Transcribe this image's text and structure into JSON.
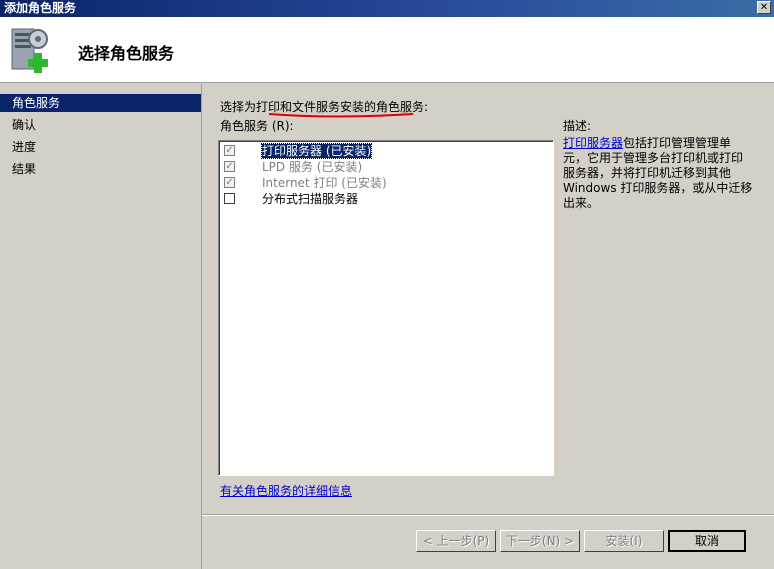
{
  "window": {
    "title": "添加角色服务",
    "close_glyph": "✕"
  },
  "header": {
    "title": "选择角色服务",
    "icon": "server-add-icon"
  },
  "sidebar": {
    "items": [
      {
        "label": "角色服务",
        "selected": true
      },
      {
        "label": "确认",
        "selected": false
      },
      {
        "label": "进度",
        "selected": false
      },
      {
        "label": "结果",
        "selected": false
      }
    ]
  },
  "main": {
    "instruction": "选择为打印和文件服务安装的角色服务:",
    "list_label": "角色服务 (R):",
    "services": [
      {
        "label": "打印服务器  (已安装)",
        "checked": true,
        "disabled": true
      },
      {
        "label": "LPD 服务  (已安装)",
        "checked": true,
        "disabled": true
      },
      {
        "label": "Internet 打印  (已安装)",
        "checked": true,
        "disabled": true
      },
      {
        "label": "分布式扫描服务器",
        "checked": false,
        "disabled": false
      }
    ],
    "description_label": "描述:",
    "description_link": "打印服务器",
    "description_text": "包括打印管理管理单元，它用于管理多台打印机或打印服务器，并将打印机迁移到其他 Windows 打印服务器，或从中迁移出来。",
    "more_info_link": "有关角色服务的详细信息"
  },
  "buttons": {
    "prev": "< 上一步(P)",
    "next": "下一步(N) >",
    "install": "安装(I)",
    "cancel": "取消"
  },
  "colors": {
    "selection": "#0a246a",
    "annotation": "#e00000",
    "link": "#0000cc"
  }
}
